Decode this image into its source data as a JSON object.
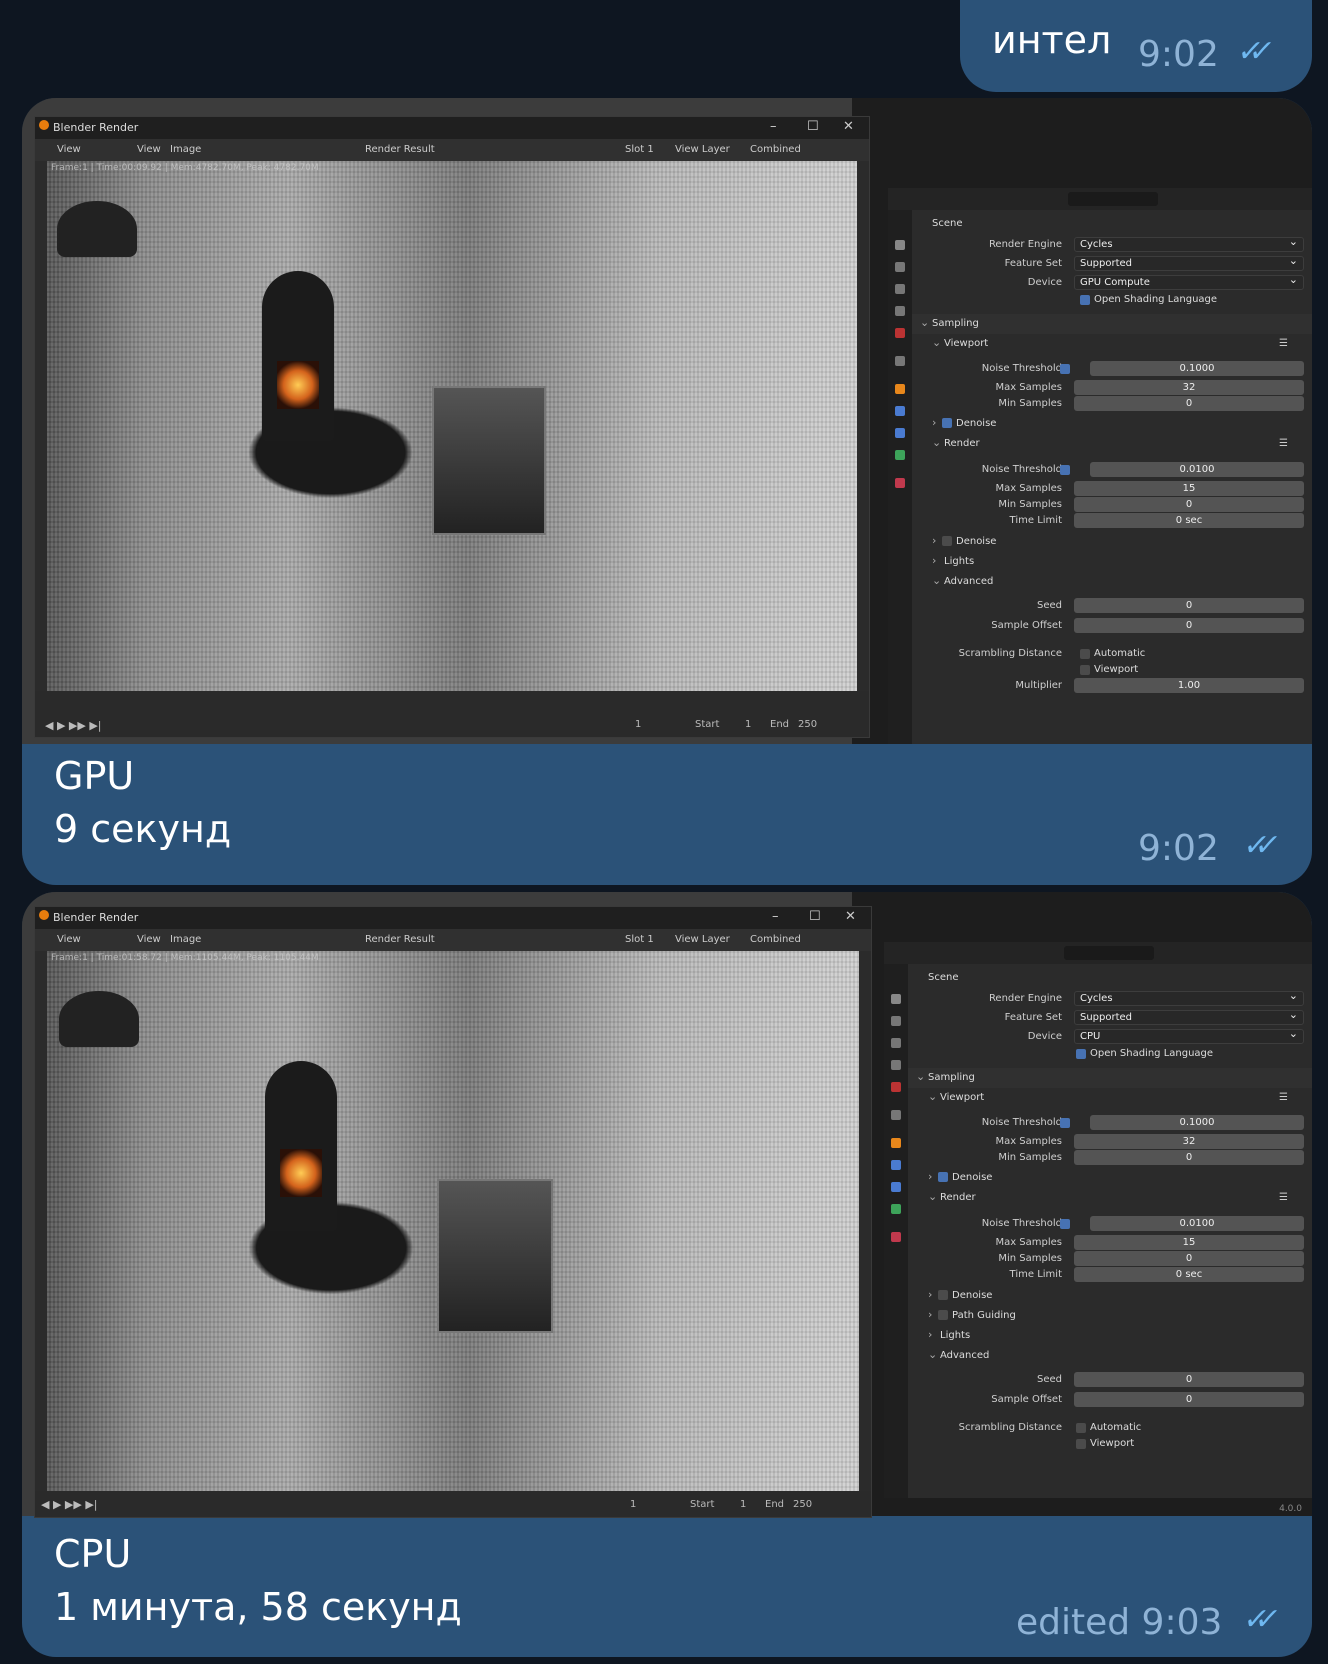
{
  "top_message": {
    "text": "интел",
    "time": "9:02"
  },
  "messages": [
    {
      "title": "GPU",
      "subtitle": "9 секунд",
      "time": "9:02",
      "screenshot": {
        "window_title": "Blender Render",
        "menu": [
          "View",
          "View",
          "Image"
        ],
        "render_result": "Render Result",
        "slot": "Slot 1",
        "view_layer": "View Layer",
        "pass": "Combined",
        "render_info": "Frame:1 | Time:00:09.92 | Mem:4782.70M, Peak: 4782.70M",
        "footer": {
          "frame": "1",
          "start_label": "Start",
          "start": "1",
          "end_label": "End",
          "end": "250"
        },
        "panel": {
          "scene": "Scene",
          "render_engine_label": "Render Engine",
          "render_engine": "Cycles",
          "feature_set_label": "Feature Set",
          "feature_set": "Supported",
          "device_label": "Device",
          "device": "GPU Compute",
          "osl": "Open Shading Language",
          "sampling": "Sampling",
          "viewport": "Viewport",
          "noise_threshold_label": "Noise Threshold",
          "vp_noise_threshold": "0.1000",
          "max_samples_label": "Max Samples",
          "vp_max_samples": "32",
          "min_samples_label": "Min Samples",
          "vp_min_samples": "0",
          "denoise": "Denoise",
          "render": "Render",
          "r_noise_threshold": "0.0100",
          "r_max_samples": "15",
          "r_min_samples": "0",
          "time_limit_label": "Time Limit",
          "time_limit": "0 sec",
          "lights": "Lights",
          "advanced": "Advanced",
          "seed_label": "Seed",
          "seed": "0",
          "sample_offset_label": "Sample Offset",
          "sample_offset": "0",
          "scrambling_label": "Scrambling Distance",
          "automatic": "Automatic",
          "viewport_chk": "Viewport",
          "multiplier_label": "Multiplier",
          "multiplier": "1.00"
        }
      }
    },
    {
      "title": "CPU",
      "subtitle": "1 минута, 58 секунд",
      "time": "edited 9:03",
      "screenshot": {
        "window_title": "Blender Render",
        "menu": [
          "View",
          "View",
          "Image"
        ],
        "render_result": "Render Result",
        "slot": "Slot 1",
        "view_layer": "View Layer",
        "pass": "Combined",
        "render_info": "Frame:1 | Time:01:58.72 | Mem:1105.44M, Peak: 1105.44M",
        "footer": {
          "frame": "1",
          "start_label": "Start",
          "start": "1",
          "end_label": "End",
          "end": "250"
        },
        "version": "4.0.0",
        "panel": {
          "scene": "Scene",
          "render_engine_label": "Render Engine",
          "render_engine": "Cycles",
          "feature_set_label": "Feature Set",
          "feature_set": "Supported",
          "device_label": "Device",
          "device": "CPU",
          "osl": "Open Shading Language",
          "sampling": "Sampling",
          "viewport": "Viewport",
          "noise_threshold_label": "Noise Threshold",
          "vp_noise_threshold": "0.1000",
          "max_samples_label": "Max Samples",
          "vp_max_samples": "32",
          "min_samples_label": "Min Samples",
          "vp_min_samples": "0",
          "denoise": "Denoise",
          "render": "Render",
          "r_noise_threshold": "0.0100",
          "r_max_samples": "15",
          "r_min_samples": "0",
          "time_limit_label": "Time Limit",
          "time_limit": "0 sec",
          "path_guiding": "Path Guiding",
          "lights": "Lights",
          "advanced": "Advanced",
          "seed_label": "Seed",
          "seed": "0",
          "sample_offset_label": "Sample Offset",
          "sample_offset": "0",
          "scrambling_label": "Scrambling Distance",
          "automatic": "Automatic",
          "viewport_chk": "Viewport"
        }
      }
    }
  ],
  "colors": {
    "background": "#0e1621",
    "bubble": "#2b5278",
    "time": "#8fb3d6",
    "ticks": "#6fb8f0"
  }
}
